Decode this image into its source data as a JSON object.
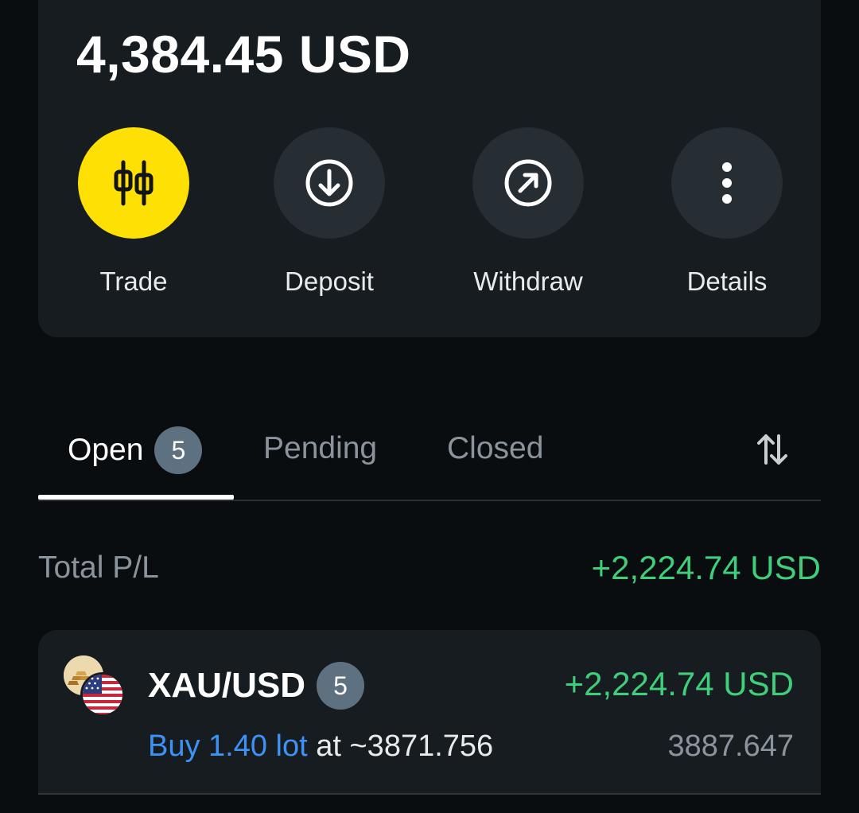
{
  "account": {
    "balance": "4,384.45 USD"
  },
  "actions": [
    {
      "label": "Trade",
      "icon": "candlestick-icon",
      "color": "#ffe005"
    },
    {
      "label": "Deposit",
      "icon": "arrow-down-circle-icon"
    },
    {
      "label": "Withdraw",
      "icon": "arrow-up-right-circle-icon"
    },
    {
      "label": "Details",
      "icon": "more-vertical-icon"
    }
  ],
  "tabs": {
    "items": [
      {
        "label": "Open",
        "badge": "5",
        "active": true
      },
      {
        "label": "Pending"
      },
      {
        "label": "Closed"
      }
    ],
    "sort_icon": "sort-arrows-icon"
  },
  "summary": {
    "total_label": "Total P/L",
    "total_value": "+2,224.74 USD"
  },
  "positions": [
    {
      "symbol": "XAU/USD",
      "count": "5",
      "pl": "+2,224.74 USD",
      "side_text": "Buy 1.40 lot",
      "at_text": " at ~3871.756",
      "current_price": "3887.647",
      "icons": [
        "gold-bars-icon",
        "us-flag-icon"
      ]
    }
  ],
  "colors": {
    "profit": "#3fcf7a",
    "buy": "#3d93f5",
    "accent": "#ffe005",
    "card": "#171c21",
    "background": "#0a0d10"
  }
}
